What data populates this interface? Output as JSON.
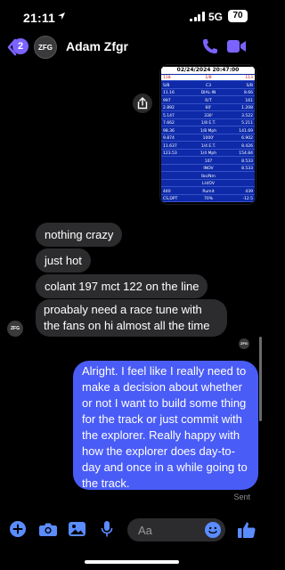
{
  "status_bar": {
    "time": "21:11",
    "network": "5G",
    "battery": "70"
  },
  "header": {
    "back_badge": "2",
    "avatar_initials": "ZFG",
    "contact_name": "Adam Zfgr"
  },
  "timeslip": {
    "date": "02/24/2024 20:47:00",
    "rows": [
      [
        "118",
        "1/8",
        "113"
      ],
      [
        "S/B",
        "C3",
        "S/B"
      ],
      [
        "11.16",
        "DIAL-IN",
        "8.66"
      ],
      [
        "997",
        "R/T",
        "161"
      ],
      [
        "2.892",
        "60'",
        "1.208"
      ],
      [
        "5.147",
        "330'",
        "3.522"
      ],
      [
        "7.662",
        "1/8 E.T.",
        "5.211"
      ],
      [
        "98.36",
        "1/8 Mph",
        "141.69"
      ],
      [
        "9.874",
        "1000'",
        "6.902"
      ],
      [
        "11.637",
        "1/4 E.T.",
        "8.426"
      ],
      [
        "123.53",
        "1/4 Mph",
        "154.84"
      ],
      [
        "",
        "107",
        "8.533"
      ],
      [
        "",
        "INOV",
        "8.533"
      ],
      [
        "",
        "Ibs/Nm",
        ""
      ],
      [
        "",
        "LH/OV",
        ""
      ],
      [
        "440",
        "Rumit",
        "439"
      ],
      [
        "CS,DPT",
        "70%",
        "-12.5"
      ]
    ]
  },
  "messages": {
    "incoming": [
      "nothing crazy",
      "just hot",
      "colant 197 mct 122 on the line",
      "proabaly need a race tune with the fans on hi almost all the time"
    ],
    "sender_avatar_initials": "ZFG",
    "read_receipt_initials": "ZFG",
    "outgoing": "Alright. I feel like I really need to make a decision about whether or not I want to build some thing for the track or just commit with the explorer. Really happy with how the explorer does day-to-day and once in a while going to the track.",
    "status": "Sent"
  },
  "composer": {
    "placeholder": "Aa"
  },
  "icons": {
    "location": "location-arrow-icon",
    "back": "chevron-left-icon",
    "call": "phone-icon",
    "video": "video-camera-icon",
    "share": "share-icon",
    "plus": "plus-circle-icon",
    "camera": "camera-icon",
    "gallery": "gallery-icon",
    "mic": "microphone-icon",
    "emoji": "emoji-icon",
    "like": "thumbs-up-icon"
  },
  "colors": {
    "accent": "#7b63ff",
    "outgoing_bubble": "#4a5cf6",
    "incoming_bubble": "#2c2c2e",
    "composer_icons": "#5b8cff"
  }
}
